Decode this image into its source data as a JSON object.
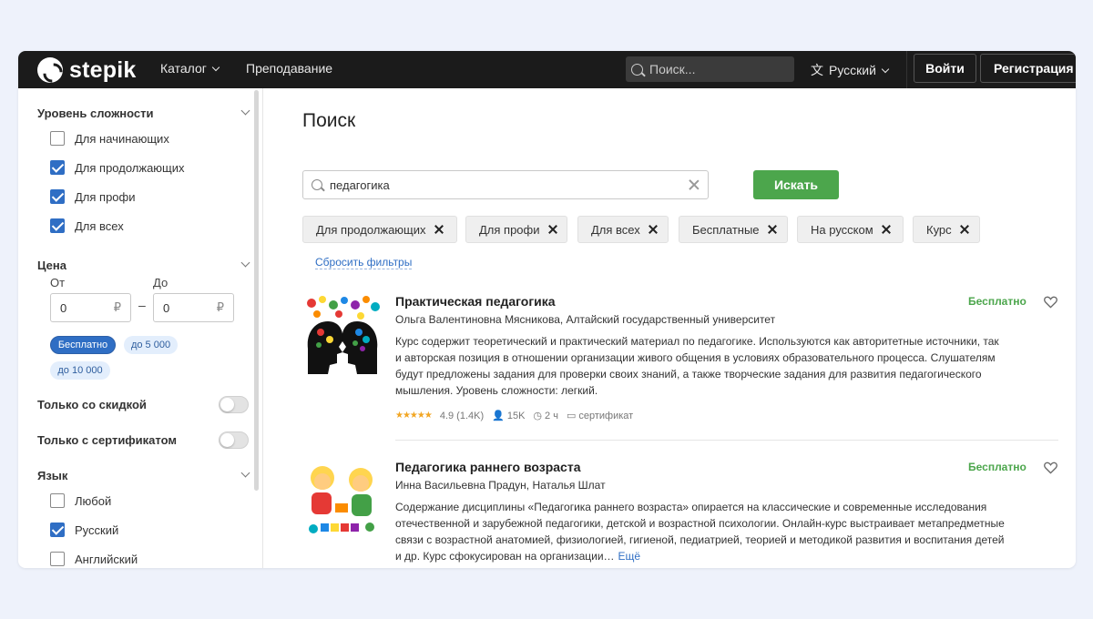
{
  "header": {
    "logo_text": "stepik",
    "nav": [
      {
        "label": "Каталог"
      },
      {
        "label": "Преподавание"
      }
    ],
    "search_placeholder": "Поиск...",
    "language": "Русский",
    "login": "Войти",
    "register": "Регистрация"
  },
  "sidebar": {
    "difficulty": {
      "title": "Уровень сложности",
      "options": [
        {
          "label": "Для начинающих",
          "checked": false
        },
        {
          "label": "Для продолжающих",
          "checked": true
        },
        {
          "label": "Для профи",
          "checked": true
        },
        {
          "label": "Для всех",
          "checked": true
        }
      ]
    },
    "price": {
      "title": "Цена",
      "from_label": "От",
      "to_label": "До",
      "from_value": "0",
      "to_value": "0",
      "currency": "₽",
      "dash": "–",
      "chips": [
        "Бесплатно",
        "до 5 000",
        "до 10 000"
      ]
    },
    "discount_label": "Только со скидкой",
    "certificate_label": "Только с сертификатом",
    "language": {
      "title": "Язык",
      "options": [
        {
          "label": "Любой",
          "checked": false
        },
        {
          "label": "Русский",
          "checked": true
        },
        {
          "label": "Английский",
          "checked": false
        }
      ]
    }
  },
  "main": {
    "title": "Поиск",
    "query": "педагогика",
    "search_button": "Искать",
    "tags": [
      "Для продолжающих",
      "Для профи",
      "Для всех",
      "Бесплатные",
      "На русском",
      "Курс"
    ],
    "reset_filters": "Сбросить фильтры",
    "courses": [
      {
        "title": "Практическая педагогика",
        "author": "Ольга Валентиновна Мясникова, Алтайский государственный университет",
        "description": "Курс содержит теоретический и практический материал по педагогике. Используются как авторитетные источники, так и авторская позиция в отношении организации живого общения в условиях образовательного процесса. Слушателям будут предложены задания для проверки своих знаний, а также творческие задания для развития педагогического мышления. Уровень сложности: легкий.",
        "price": "Бесплатно",
        "rating": "4.9 (1.4K)",
        "learners": "15K",
        "duration": "2 ч",
        "certificate": "сертификат"
      },
      {
        "title": "Педагогика раннего возраста",
        "author": "Инна Васильевна Прадун, Наталья Шлат",
        "description": "Содержание дисциплины «Педагогика раннего возраста» опирается на классические и современные исследования отечественной и зарубежной педагогики, детской и возрастной психологии. Онлайн-курс выстраивает метапредметные связи с возрастной анатомией, физиологией, гигиеной, педиатрией, теорией и методикой развития и воспитания детей и др. Курс сфокусирован на организации…",
        "more": "Ещё",
        "price": "Бесплатно"
      }
    ]
  },
  "colors": {
    "header_bg": "#1b1b1b",
    "accent_blue": "#2f6ec4",
    "accent_green": "#4ca64c",
    "star": "#f2a623"
  }
}
